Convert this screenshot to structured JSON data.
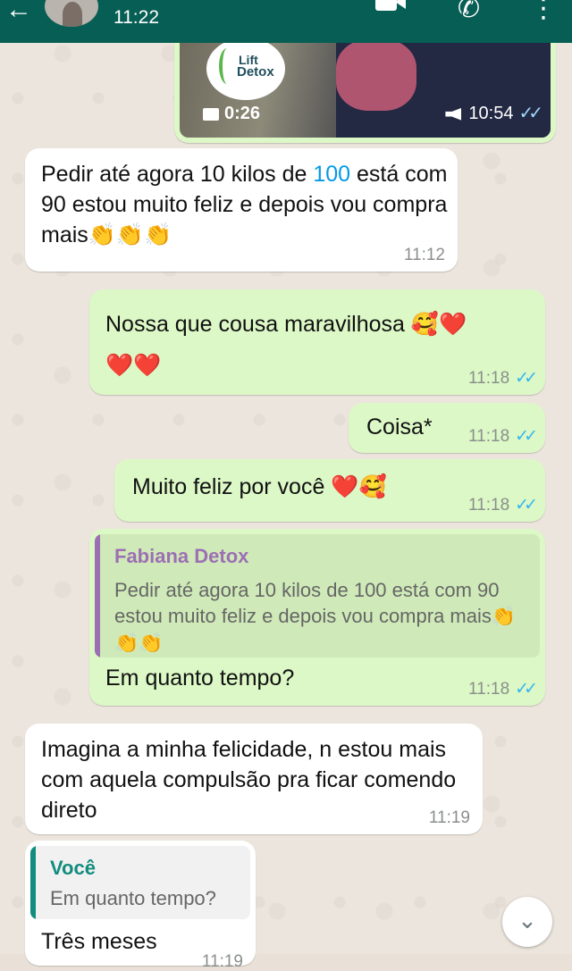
{
  "header": {
    "time": "11:22"
  },
  "video_message": {
    "logo_line1": "Lift",
    "logo_line2": "Detox",
    "duration": "0:26",
    "time": "10:54"
  },
  "messages": [
    {
      "text_a": "Pedir até agora 10 kilos de ",
      "text_link": "100",
      "text_b": " está com 90 estou muito feliz e depois vou compra mais",
      "emoji": "👏👏👏",
      "time": "11:12"
    },
    {
      "text": "Nossa que cousa maravilhosa",
      "emoji": "🥰❤️❤️❤️",
      "time": "11:18"
    },
    {
      "text": "Coisa*",
      "time": "11:18"
    },
    {
      "text": "Muito feliz por você ",
      "emoji": "❤️🥰",
      "time": "11:18"
    },
    {
      "quote_name": "Fabiana Detox",
      "quote_text": "Pedir até agora 10 kilos de 100 está com 90 estou muito feliz e depois vou compra mais",
      "quote_emoji": "👏👏👏",
      "text": "Em quanto tempo?",
      "time": "11:18"
    },
    {
      "text": "Imagina a minha felicidade, n estou mais com aquela compulsão pra ficar comendo direto",
      "time": "11:19"
    },
    {
      "quote_name": "Você",
      "quote_text": "Em quanto tempo?",
      "text": "Três meses",
      "time": "11:19"
    }
  ],
  "colors": {
    "header": "#075e54",
    "outgoing": "#dcf8c6",
    "incoming": "#ffffff",
    "read_ticks": "#34b7f1",
    "quote_other": "#9c6fb4",
    "quote_self": "#128c7e"
  }
}
